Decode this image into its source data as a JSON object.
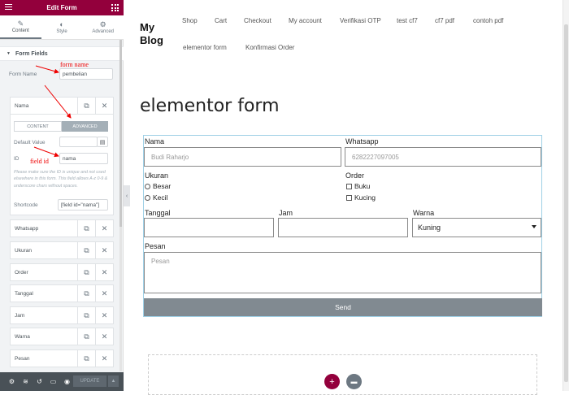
{
  "panel": {
    "title": "Edit Form",
    "tabs": [
      {
        "label": "Content",
        "icon": "pencil-icon"
      },
      {
        "label": "Style",
        "icon": "half-circle-icon"
      },
      {
        "label": "Advanced",
        "icon": "gear-icon"
      }
    ],
    "section": "Form Fields",
    "form_name_label": "Form Name",
    "form_name_value": "pembelian",
    "expanded_field": "Nama",
    "seg_content": "CONTENT",
    "seg_advanced": "ADVANCED",
    "default_value_label": "Default Value",
    "id_label": "ID",
    "id_value": "nama",
    "help_text": "Please make sure the ID is unique and not used elsewhere in this form. This field allows A-z  0-9  & underscore chars without spaces.",
    "shortcode_label": "Shortcode",
    "shortcode_value": "[field id=\"nama\"]",
    "fields": [
      "Whatsapp",
      "Ukuran",
      "Order",
      "Tanggal",
      "Jam",
      "Warna",
      "Pesan"
    ],
    "update_label": "UPDATE",
    "annotations": {
      "form_name": "form name",
      "field_id": "field id"
    }
  },
  "site": {
    "logo": "My Blog",
    "nav": [
      "Shop",
      "Cart",
      "Checkout",
      "My account",
      "Verifikasi OTP",
      "test cf7",
      "cf7 pdf",
      "contoh pdf",
      "elementor form",
      "Konfirmasi Order"
    ],
    "page_title": "elementor form",
    "form": {
      "nama_label": "Nama",
      "nama_placeholder": "Budi Raharjo",
      "whatsapp_label": "Whatsapp",
      "whatsapp_placeholder": "6282227097005",
      "ukuran_label": "Ukuran",
      "ukuran_options": [
        "Besar",
        "Kecil"
      ],
      "order_label": "Order",
      "order_options": [
        "Buku",
        "Kucing"
      ],
      "tanggal_label": "Tanggal",
      "jam_label": "Jam",
      "warna_label": "Warna",
      "warna_selected": "Kuning",
      "pesan_label": "Pesan",
      "pesan_placeholder": "Pesan",
      "send_label": "Send"
    }
  },
  "colors": {
    "panel_header": "#93003c",
    "send_button": "#818a91",
    "annotation": "#ee0000"
  }
}
